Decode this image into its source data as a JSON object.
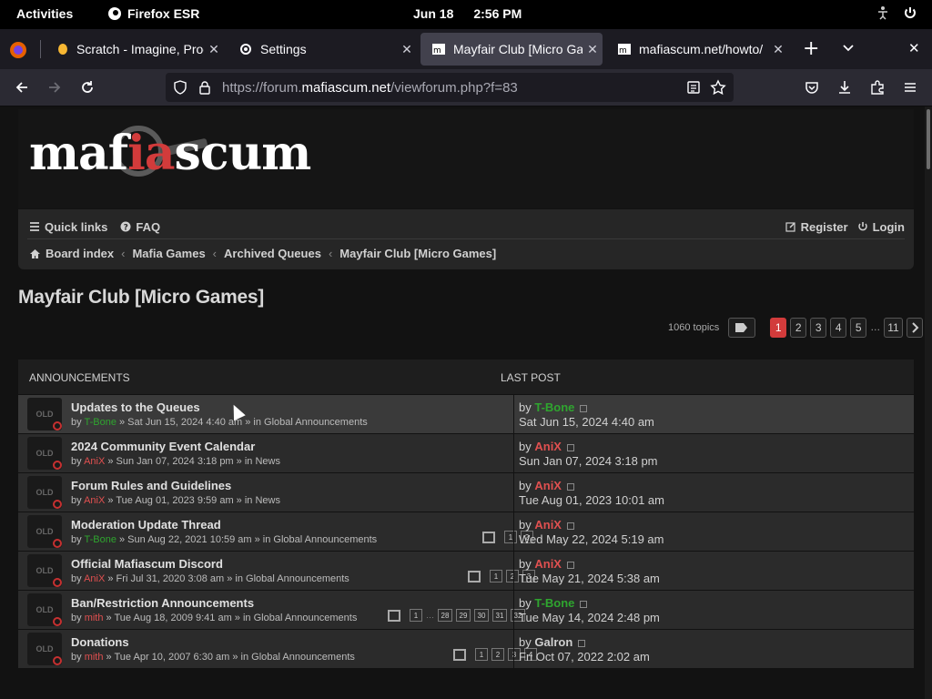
{
  "system": {
    "activities": "Activities",
    "app": "Firefox ESR",
    "date": "Jun 18",
    "time": "2:56 PM"
  },
  "tabs": [
    {
      "label": "Scratch - Imagine, Progr",
      "active": false
    },
    {
      "label": "Settings",
      "active": false
    },
    {
      "label": "Mayfair Club [Micro Ga",
      "active": true
    },
    {
      "label": "mafiascum.net/howto/",
      "active": false
    }
  ],
  "urlbar": {
    "prefix": "https://forum.",
    "domain": "mafiascum.net",
    "path": "/viewforum.php?f=83"
  },
  "site": {
    "logo_left": "maf",
    "logo_red": "ia",
    "logo_right": "scum",
    "quick_links": "Quick links",
    "faq": "FAQ",
    "register": "Register",
    "login": "Login"
  },
  "breadcrumb": [
    "Board index",
    "Mafia Games",
    "Archived Queues",
    "Mayfair Club [Micro Games]"
  ],
  "forum_title": "Mayfair Club [Micro Games]",
  "pagination": {
    "count": "1060 topics",
    "pages": [
      "1",
      "2",
      "3",
      "4",
      "5"
    ],
    "ellipsis": "…",
    "last": "11"
  },
  "announcements": {
    "header_left": "ANNOUNCEMENTS",
    "header_right": "LAST POST",
    "icon_text": "OLD",
    "rows": [
      {
        "title": "Updates to the Queues",
        "by": "by",
        "author": "T-Bone",
        "author_color": "green",
        "meta": " » Sat Jun 15, 2024 4:40 am » in Global Announcements",
        "pages": [],
        "lp_by": "by",
        "lp_author": "T-Bone",
        "lp_color": "green",
        "lp_date": "Sat Jun 15, 2024 4:40 am"
      },
      {
        "title": "2024 Community Event Calendar",
        "by": "by",
        "author": "AniX",
        "author_color": "red",
        "meta": " » Sun Jan 07, 2024 3:18 pm » in News",
        "pages": [],
        "lp_by": "by",
        "lp_author": "AniX",
        "lp_color": "red",
        "lp_date": "Sun Jan 07, 2024 3:18 pm"
      },
      {
        "title": "Forum Rules and Guidelines",
        "by": "by",
        "author": "AniX",
        "author_color": "red",
        "meta": " » Tue Aug 01, 2023 9:59 am » in News",
        "pages": [],
        "lp_by": "by",
        "lp_author": "AniX",
        "lp_color": "red",
        "lp_date": "Tue Aug 01, 2023 10:01 am"
      },
      {
        "title": "Moderation Update Thread",
        "by": "by",
        "author": "T-Bone",
        "author_color": "green",
        "meta": " » Sun Aug 22, 2021 10:59 am » in Global Announcements",
        "pages": [
          "1",
          "2"
        ],
        "lp_by": "by",
        "lp_author": "AniX",
        "lp_color": "red",
        "lp_date": "Wed May 22, 2024 5:19 am"
      },
      {
        "title": "Official Mafiascum Discord",
        "by": "by",
        "author": "AniX",
        "author_color": "red",
        "meta": " » Fri Jul 31, 2020 3:08 am » in Global Announcements",
        "pages": [
          "1",
          "2",
          "3"
        ],
        "lp_by": "by",
        "lp_author": "AniX",
        "lp_color": "red",
        "lp_date": "Tue May 21, 2024 5:38 am"
      },
      {
        "title": "Ban/Restriction Announcements",
        "by": "by",
        "author": "mith",
        "author_color": "red",
        "meta": " » Tue Aug 18, 2009 9:41 am » in Global Announcements",
        "pages": [
          "1",
          "…",
          "28",
          "29",
          "30",
          "31",
          "32"
        ],
        "lp_by": "by",
        "lp_author": "T-Bone",
        "lp_color": "green",
        "lp_date": "Tue May 14, 2024 2:48 pm"
      },
      {
        "title": "Donations",
        "by": "by",
        "author": "mith",
        "author_color": "red",
        "meta": " » Tue Apr 10, 2007 6:30 am » in Global Announcements",
        "pages": [
          "1",
          "2",
          "3",
          "4"
        ],
        "lp_by": "by",
        "lp_author": "Galron",
        "lp_color": "plain",
        "lp_date": "Fri Oct 07, 2022 2:02 am"
      }
    ]
  },
  "colors": {
    "accent": "#d23b3b",
    "mod_green": "#2fa52f",
    "admin_red": "#e05050"
  }
}
